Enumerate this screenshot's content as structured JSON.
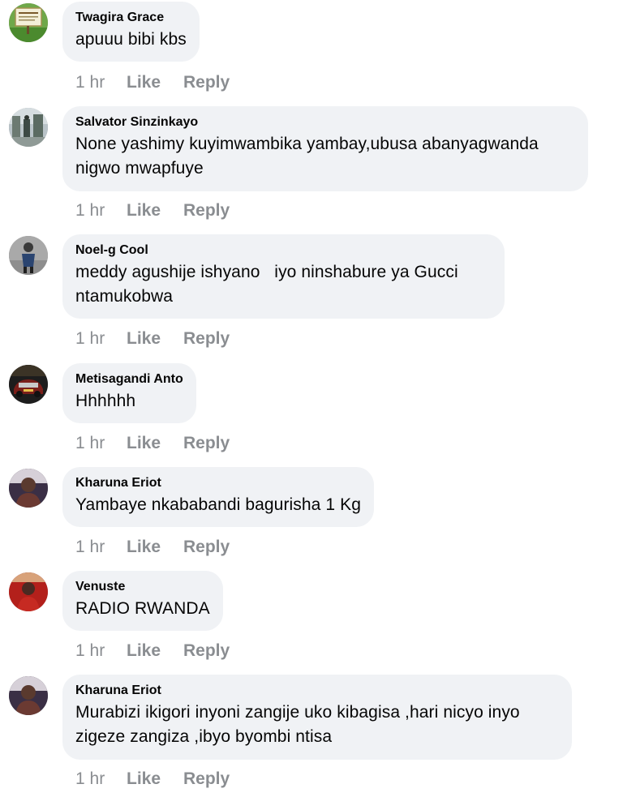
{
  "comments": [
    {
      "author": "Twagira Grace",
      "text": "apuuu bibi kbs",
      "time": "1 hr",
      "like": "Like",
      "reply": "Reply",
      "avatar": "sign-photo"
    },
    {
      "author": "Salvator Sinzinkayo",
      "text": "None yashimy kuyimwambika yambay,ubusa abanyagwanda nigwo mwapfuye",
      "time": "1 hr",
      "like": "Like",
      "reply": "Reply",
      "avatar": "street-photo"
    },
    {
      "author": "Noel-g Cool",
      "text": "meddy agushije ishyano   iyo ninshabure ya Gucci ntamukobwa",
      "time": "1 hr",
      "like": "Like",
      "reply": "Reply",
      "avatar": "person-photo"
    },
    {
      "author": "Metisagandi Anto",
      "text": "Hhhhhh",
      "time": "1 hr",
      "like": "Like",
      "reply": "Reply",
      "avatar": "car-photo"
    },
    {
      "author": "Kharuna Eriot",
      "text": "Yambaye nkababandi bagurisha 1 Kg",
      "time": "1 hr",
      "like": "Like",
      "reply": "Reply",
      "avatar": "man-photo"
    },
    {
      "author": "Venuste",
      "text": "RADIO RWANDA",
      "time": "1 hr",
      "like": "Like",
      "reply": "Reply",
      "avatar": "red-photo"
    },
    {
      "author": "Kharuna Eriot",
      "text": "Murabizi ikigori inyoni zangije uko kibagisa ,hari nicyo inyo zigeze zangiza ,ibyo byombi ntisa",
      "time": "1 hr",
      "like": "Like",
      "reply": "Reply",
      "avatar": "man-photo"
    }
  ]
}
